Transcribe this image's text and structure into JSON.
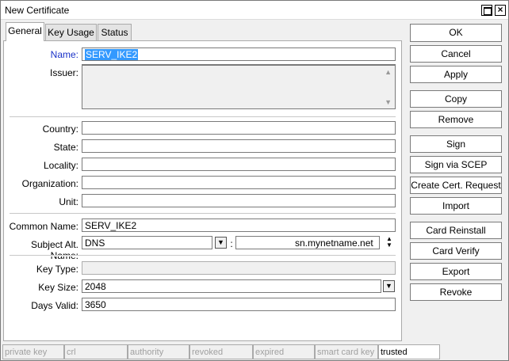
{
  "window": {
    "title": "New Certificate"
  },
  "tabs": [
    {
      "label": "General",
      "active": true
    },
    {
      "label": "Key Usage",
      "active": false
    },
    {
      "label": "Status",
      "active": false
    }
  ],
  "general": {
    "name": {
      "label": "Name:",
      "value": "SERV_IKE2"
    },
    "issuer": {
      "label": "Issuer:",
      "value": ""
    },
    "country": {
      "label": "Country:",
      "value": ""
    },
    "state": {
      "label": "State:",
      "value": ""
    },
    "locality": {
      "label": "Locality:",
      "value": ""
    },
    "organization": {
      "label": "Organization:",
      "value": ""
    },
    "unit": {
      "label": "Unit:",
      "value": ""
    },
    "common_name": {
      "label": "Common Name:",
      "value": "SERV_IKE2"
    },
    "subject_alt_name": {
      "label": "Subject Alt. Name:",
      "type": "DNS",
      "separator": ":",
      "value": "sn.mynetname.net"
    },
    "key_type": {
      "label": "Key Type:",
      "value": ""
    },
    "key_size": {
      "label": "Key Size:",
      "value": "2048"
    },
    "days_valid": {
      "label": "Days Valid:",
      "value": "3650"
    }
  },
  "buttons": {
    "ok": "OK",
    "cancel": "Cancel",
    "apply": "Apply",
    "copy": "Copy",
    "remove": "Remove",
    "sign": "Sign",
    "sign_via_scep": "Sign via SCEP",
    "create_cert_request": "Create Cert. Request",
    "import": "Import",
    "card_reinstall": "Card Reinstall",
    "card_verify": "Card Verify",
    "export": "Export",
    "revoke": "Revoke"
  },
  "status_flags": [
    {
      "label": "private key",
      "active": false
    },
    {
      "label": "crl",
      "active": false
    },
    {
      "label": "authority",
      "active": false
    },
    {
      "label": "revoked",
      "active": false
    },
    {
      "label": "expired",
      "active": false
    },
    {
      "label": "smart card key",
      "active": false
    },
    {
      "label": "trusted",
      "active": true
    }
  ]
}
